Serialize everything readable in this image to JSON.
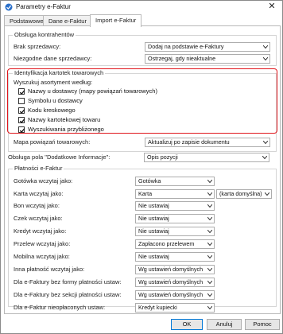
{
  "window": {
    "title": "Parametry e-Faktur",
    "close_symbol": "✕"
  },
  "tabs": [
    {
      "label": "Podstawowe"
    },
    {
      "label": "Dane e-Faktur"
    },
    {
      "label": "Import e-Faktur"
    }
  ],
  "active_tab": 2,
  "kontrahenci": {
    "title": "Obsługa kontrahentów",
    "brak_label": "Brak sprzedawcy:",
    "brak_value": "Dodaj na podstawie e-Faktury",
    "niezgodne_label": "Niezgodne dane sprzedawcy:",
    "niezgodne_value": "Ostrzegaj, gdy nieaktualne"
  },
  "identyfikacja": {
    "title": "Identyfikacja kartotek towarowych",
    "search_label": "Wyszukuj asortyment według:",
    "options": [
      {
        "label": "Nazwy u dostawcy (mapy powiązań towarowych)",
        "checked": true
      },
      {
        "label": "Symbolu u dostawcy",
        "checked": false
      },
      {
        "label": "Kodu kreskowego",
        "checked": true
      },
      {
        "label": "Nazwy kartotekowej towaru",
        "checked": true
      },
      {
        "label": "Wyszukiwania przybliżonego",
        "checked": true
      }
    ],
    "mapa_label": "Mapa powiązań towarowych:",
    "mapa_value": "Aktualizuj po zapisie dokumentu"
  },
  "dodatkowe": {
    "label": "Obsługa pola \"Dodatkowe Informacje\":",
    "value": "Opis pozycji"
  },
  "platnosci": {
    "title": "Płatności e-Faktur",
    "rows": [
      {
        "label": "Gotówka wczytaj jako:",
        "value": "Gotówka"
      },
      {
        "label": "Karta wczytaj jako:",
        "value": "Karta",
        "extra": "(karta domyślna)"
      },
      {
        "label": "Bon wczytaj jako:",
        "value": "Nie ustawiaj"
      },
      {
        "label": "Czek wczytaj jako:",
        "value": "Nie ustawiaj"
      },
      {
        "label": "Kredyt wczytaj jako:",
        "value": "Nie ustawiaj"
      },
      {
        "label": "Przelew wczytaj jako:",
        "value": "Zapłacono przelewem"
      },
      {
        "label": "Mobilna wczytaj jako:",
        "value": "Nie ustawiaj"
      },
      {
        "label": "Inna płatność wczytaj jako:",
        "value": "Wg ustawień domyślnych"
      },
      {
        "label": "Dla e-Faktury bez formy płatności ustaw:",
        "value": "Wg ustawień domyślnych"
      },
      {
        "label": "Dla e-Faktury bez sekcji płatności ustaw:",
        "value": "Wg ustawień domyślnych"
      },
      {
        "label": "Dla e-Faktur nieopłaconych ustaw:",
        "value": "Kredyt kupiecki"
      }
    ]
  },
  "buttons": {
    "ok": "OK",
    "cancel": "Anuluj",
    "help": "Pomoc"
  },
  "colors": {
    "highlight": "#e0151b",
    "accent": "#0078d7"
  }
}
